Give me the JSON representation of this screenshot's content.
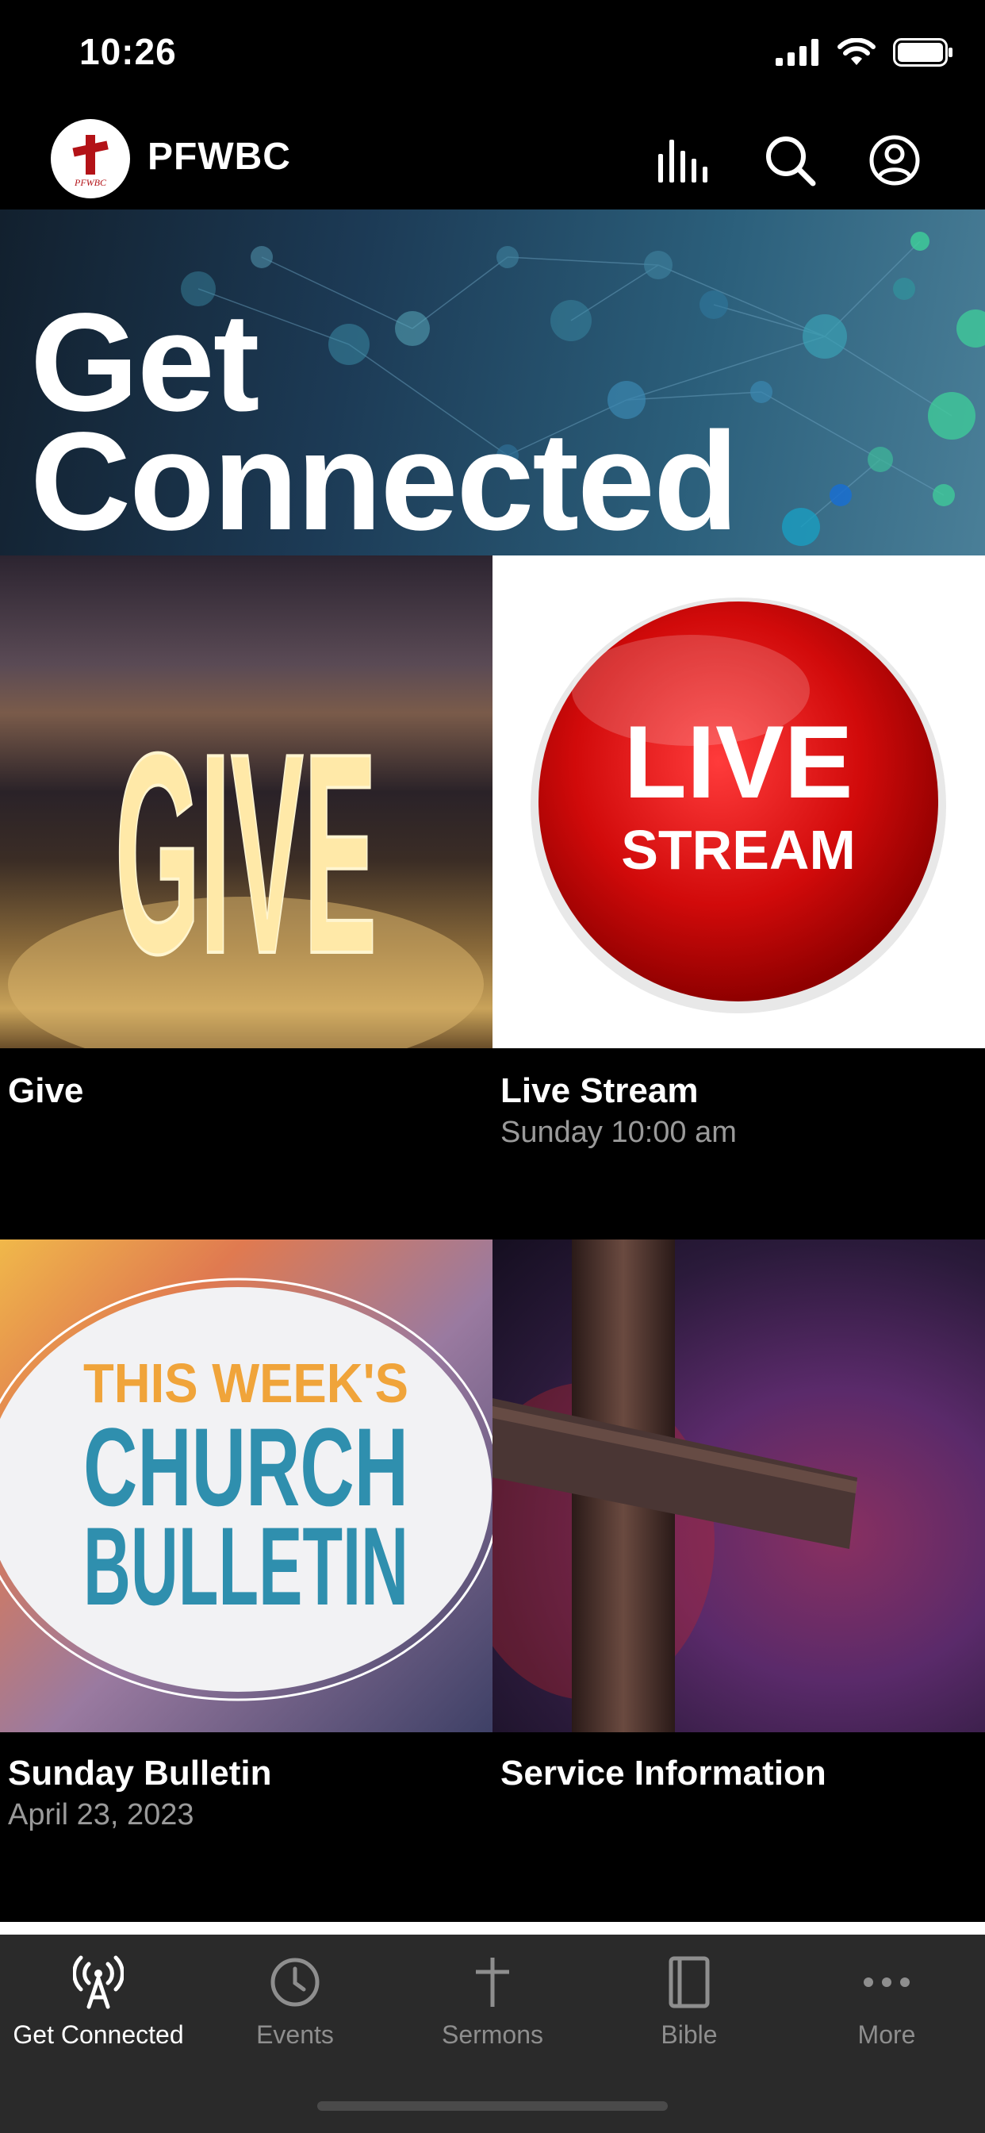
{
  "status_bar": {
    "time": "10:26"
  },
  "header": {
    "title": "PFWBC",
    "logo_text": "PFWBC"
  },
  "banner": {
    "line1": "Get",
    "line2": "Connected"
  },
  "tiles": [
    {
      "title": "Give",
      "subtitle": "",
      "image_text": "GIVE"
    },
    {
      "title": "Live Stream",
      "subtitle": "Sunday 10:00 am",
      "image_line1": "LIVE",
      "image_line2": "STREAM"
    },
    {
      "title": "Sunday Bulletin",
      "subtitle": "April 23, 2023",
      "image_line1": "THIS WEEK'S",
      "image_line2": "CHURCH",
      "image_line3": "BULLETIN"
    },
    {
      "title": "Service Information",
      "subtitle": ""
    }
  ],
  "tabs": [
    {
      "label": "Get Connected",
      "icon": "broadcast-icon",
      "active": true
    },
    {
      "label": "Events",
      "icon": "clock-icon",
      "active": false
    },
    {
      "label": "Sermons",
      "icon": "plus-icon",
      "active": false
    },
    {
      "label": "Bible",
      "icon": "book-icon",
      "active": false
    },
    {
      "label": "More",
      "icon": "more-dots-icon",
      "active": false
    }
  ],
  "colors": {
    "accent_red": "#cc1f1f",
    "tab_bar_bg": "#2a2a2a",
    "bulletin_orange": "#f0a43a",
    "bulletin_blue": "#2f8fae"
  }
}
